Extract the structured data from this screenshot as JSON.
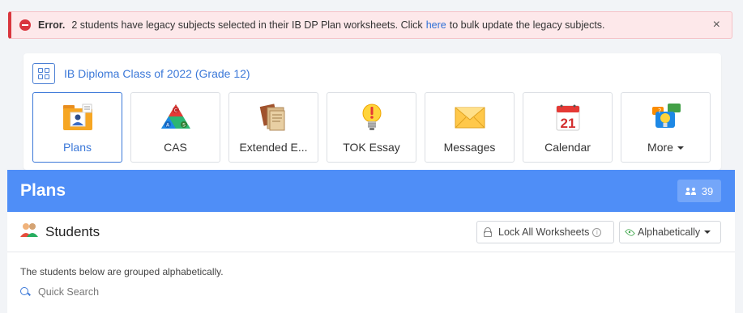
{
  "alert": {
    "label": "Error.",
    "message_before": "2 students have legacy subjects selected in their IB DP Plan worksheets. Click",
    "link": "here",
    "message_after": "to bulk update the legacy subjects.",
    "close": "×",
    "color": "#d9363e"
  },
  "class_card": {
    "title": "IB Diploma Class of 2022 (Grade 12)",
    "tiles": [
      {
        "label": "Plans",
        "icon": "folder-person-icon",
        "active": true
      },
      {
        "label": "CAS",
        "icon": "cas-triangle-icon"
      },
      {
        "label": "Extended E...",
        "icon": "documents-icon"
      },
      {
        "label": "TOK Essay",
        "icon": "lightbulb-icon"
      },
      {
        "label": "Messages",
        "icon": "envelope-icon"
      },
      {
        "label": "Calendar",
        "icon": "calendar-icon",
        "day": "21"
      },
      {
        "label": "More",
        "icon": "chat-lightbulb-icon"
      }
    ]
  },
  "plans": {
    "title": "Plans",
    "count": "39",
    "header_color": "#4f8ef7"
  },
  "students": {
    "title": "Students",
    "lock_button": "Lock All Worksheets",
    "sort_button": "Alphabetically",
    "group_note": "The students below are grouped alphabetically.",
    "search_placeholder": "Quick Search"
  }
}
